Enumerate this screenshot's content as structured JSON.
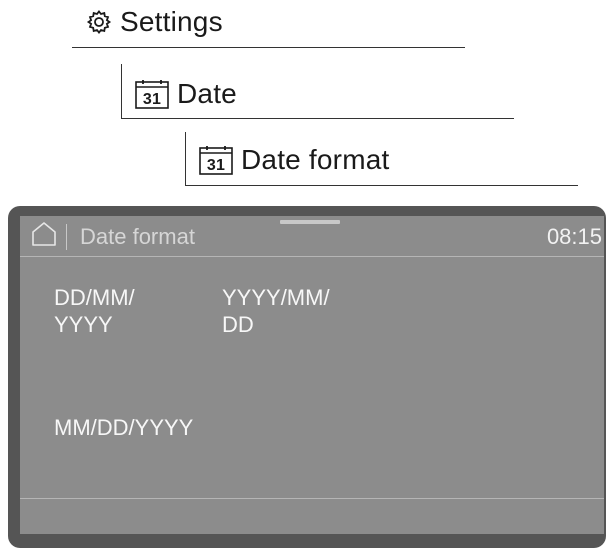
{
  "breadcrumb": {
    "level1": {
      "label": "Settings",
      "icon": "gear-icon"
    },
    "level2": {
      "label": "Date",
      "icon": "calendar-icon",
      "icon_text": "31"
    },
    "level3": {
      "label": "Date format",
      "icon": "calendar-icon",
      "icon_text": "31"
    }
  },
  "status_bar": {
    "home_icon": "home-icon",
    "title": "Date format",
    "time": "08:15"
  },
  "options": [
    {
      "label": "DD/MM/\nYYYY"
    },
    {
      "label": "YYYY/MM/\nDD"
    },
    {
      "label": "MM/DD/YYYY"
    }
  ],
  "colors": {
    "device_frame": "#555555",
    "screen_bg": "#8c8c8c",
    "screen_text": "#f7f7f7",
    "title_text": "#d6d6d6"
  }
}
